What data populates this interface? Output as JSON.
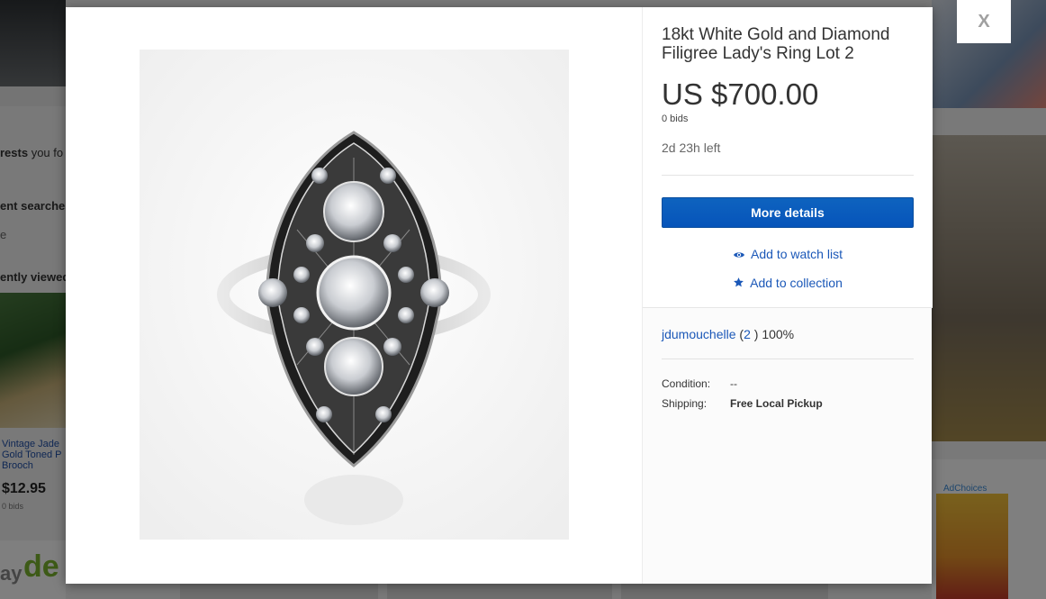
{
  "background": {
    "left_interests_text_bold": "rests",
    "left_interests_text": "you fo",
    "left_recent_searches": "ent searches",
    "left_recent_item": "e",
    "left_recently_viewed": "ently viewed",
    "left_item_title": "Vintage Jade Gold Toned P Brooch",
    "left_item_price": "$12.95",
    "left_item_bids": "0 bids",
    "left_deal_text": "de",
    "left_deal_prefix": "ay",
    "right_ad_choices": "AdChoices"
  },
  "modal": {
    "close_label": "X",
    "listing": {
      "title": "18kt White Gold and Diamond Filigree Lady's Ring Lot 2",
      "price": "US $700.00",
      "bids": "0 bids",
      "time_left": "2d 23h left",
      "more_details_label": "More details",
      "watch_label": "Add to watch list",
      "collection_label": "Add to collection"
    },
    "seller": {
      "name": "jdumouchelle",
      "feedback_open": "(",
      "feedback_count": "2",
      "feedback_close": ")",
      "positive": "100%"
    },
    "details": {
      "condition_label": "Condition:",
      "condition_value": "--",
      "shipping_label": "Shipping:",
      "shipping_value": "Free Local Pickup"
    },
    "icons": {
      "watch": "eye-icon",
      "collection": "star-icon"
    }
  }
}
